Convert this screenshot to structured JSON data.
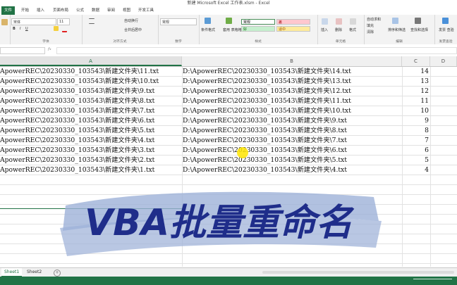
{
  "window": {
    "title": "新建 Microsoft Excel 工作表.xlsm - Excel"
  },
  "menu": [
    "文件",
    "开始",
    "插入",
    "页面布局",
    "公式",
    "数据",
    "审阅",
    "视图",
    "开发工具"
  ],
  "ribbon": {
    "font_name": "宋体",
    "font_size": "11",
    "wrap_label": "自动换行",
    "merge_label": "合并后居中",
    "number_format": "常规",
    "cond_format": "条件格式",
    "table_format": "套用\n表格格式",
    "style_normal": "常规",
    "style_bad": "差",
    "style_good": "好",
    "style_neutral": "适中",
    "insert": "插入",
    "delete": "删除",
    "format": "格式",
    "autosum": "自动求和",
    "fill": "填充",
    "clear": "清除",
    "sort_filter": "排序和筛选",
    "find_select": "查找和选择",
    "invoice": "发票\n查验",
    "groups": [
      "剪贴板",
      "字体",
      "对齐方式",
      "数字",
      "样式",
      "单元格",
      "编辑",
      "发票查验"
    ]
  },
  "columns": [
    "A",
    "B",
    "C",
    "D"
  ],
  "rows": [
    {
      "a": "ApowerREC\\20230330_103543\\新建文件夹\\11.txt",
      "b": "D:\\ApowerREC\\20230330_103543\\新建文件夹\\14.txt",
      "c": "14"
    },
    {
      "a": "ApowerREC\\20230330_103543\\新建文件夹\\10.txt",
      "b": "D:\\ApowerREC\\20230330_103543\\新建文件夹\\13.txt",
      "c": "13"
    },
    {
      "a": "ApowerREC\\20230330_103543\\新建文件夹\\9.txt",
      "b": "D:\\ApowerREC\\20230330_103543\\新建文件夹\\12.txt",
      "c": "12"
    },
    {
      "a": "ApowerREC\\20230330_103543\\新建文件夹\\8.txt",
      "b": "D:\\ApowerREC\\20230330_103543\\新建文件夹\\11.txt",
      "c": "11"
    },
    {
      "a": "ApowerREC\\20230330_103543\\新建文件夹\\7.txt",
      "b": "D:\\ApowerREC\\20230330_103543\\新建文件夹\\10.txt",
      "c": "10"
    },
    {
      "a": "ApowerREC\\20230330_103543\\新建文件夹\\6.txt",
      "b": "D:\\ApowerREC\\20230330_103543\\新建文件夹\\9.txt",
      "c": "9"
    },
    {
      "a": "ApowerREC\\20230330_103543\\新建文件夹\\5.txt",
      "b": "D:\\ApowerREC\\20230330_103543\\新建文件夹\\8.txt",
      "c": "8"
    },
    {
      "a": "ApowerREC\\20230330_103543\\新建文件夹\\4.txt",
      "b": "D:\\ApowerREC\\20230330_103543\\新建文件夹\\7.txt",
      "c": "7"
    },
    {
      "a": "ApowerREC\\20230330_103543\\新建文件夹\\3.txt",
      "b": "D:\\ApowerREC\\20230330_103543\\新建文件夹\\6.txt",
      "c": "6"
    },
    {
      "a": "ApowerREC\\20230330_103543\\新建文件夹\\2.txt",
      "b": "D:\\ApowerREC\\20230330_103543\\新建文件夹\\5.txt",
      "c": "5"
    },
    {
      "a": "ApowerREC\\20230330_103543\\新建文件夹\\1.txt",
      "b": "D:\\ApowerREC\\20230330_103543\\新建文件夹\\4.txt",
      "c": "4"
    }
  ],
  "sheets": [
    "Sheet1",
    "Sheet2"
  ],
  "overlay": {
    "text": "VBA批量重命名",
    "color": "#1f2d8a",
    "brush": "#9eb2d8"
  },
  "colors": {
    "excel_green": "#217346",
    "style_bad_bg": "#ffc7ce",
    "style_good_bg": "#c6efce",
    "style_neutral_bg": "#ffeb9c"
  }
}
